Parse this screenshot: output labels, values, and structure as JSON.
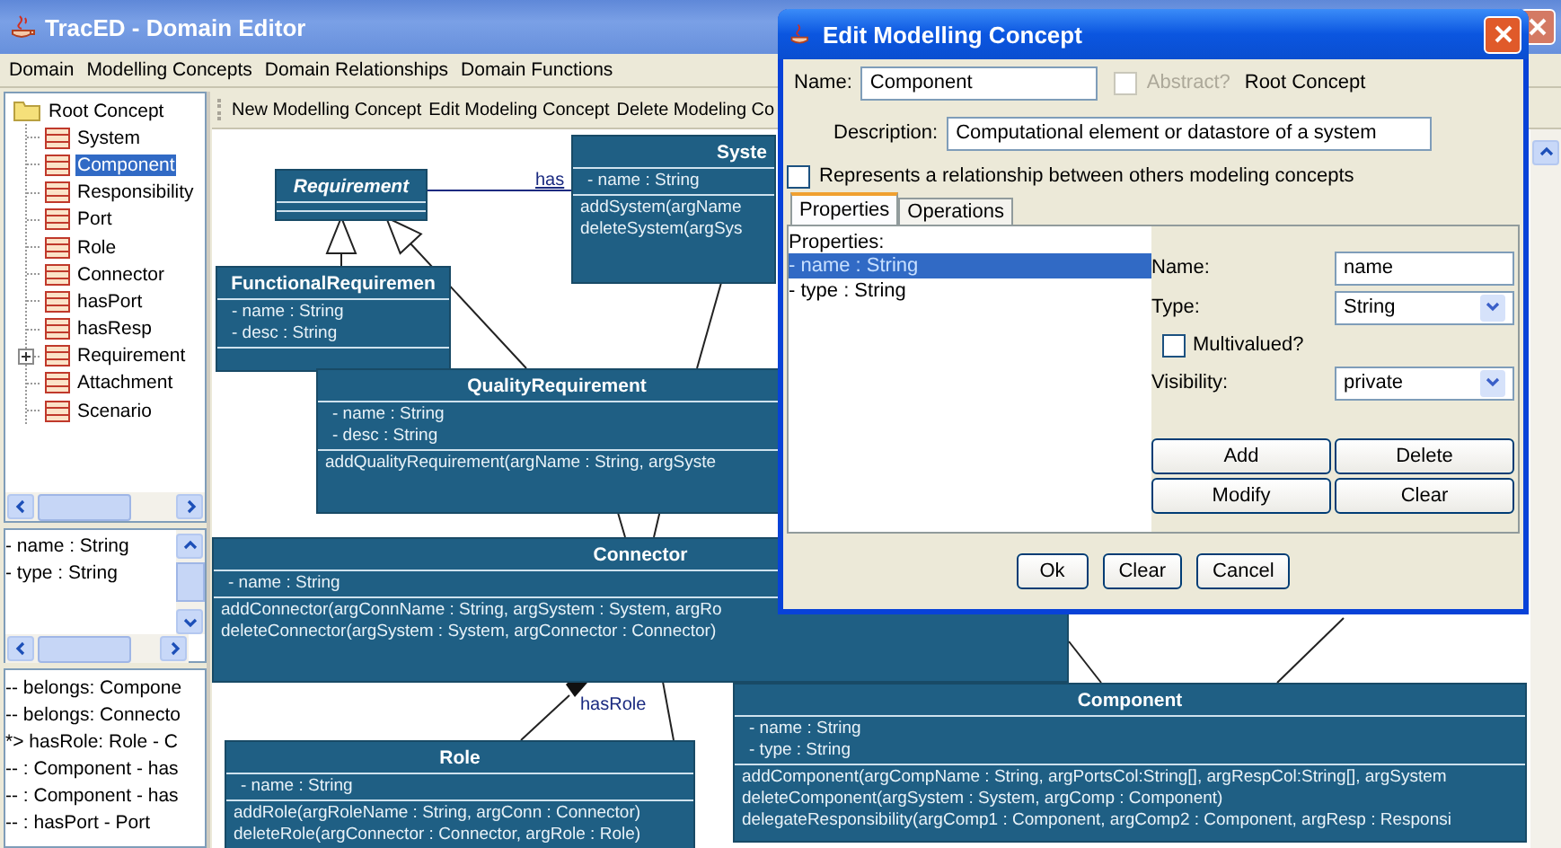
{
  "window": {
    "title": "TracED - Domain Editor"
  },
  "menu": [
    "Domain",
    "Modelling Concepts",
    "Domain Relationships",
    "Domain Functions"
  ],
  "toolbar": [
    "New Modelling Concept",
    "Edit Modeling Concept",
    "Delete Modeling Co"
  ],
  "tree": {
    "label": "Root Concept",
    "children": [
      {
        "label": "System",
        "selected": false,
        "collapsed": false
      },
      {
        "label": "Component",
        "selected": true,
        "collapsed": false
      },
      {
        "label": "Responsibility",
        "selected": false,
        "collapsed": false
      },
      {
        "label": "Port",
        "selected": false,
        "collapsed": false
      },
      {
        "label": "Role",
        "selected": false,
        "collapsed": false
      },
      {
        "label": "Connector",
        "selected": false,
        "collapsed": false
      },
      {
        "label": "hasPort",
        "selected": false,
        "collapsed": false
      },
      {
        "label": "hasResp",
        "selected": false,
        "collapsed": false
      },
      {
        "label": "Requirement",
        "selected": false,
        "collapsed": true
      },
      {
        "label": "Attachment",
        "selected": false,
        "collapsed": false
      },
      {
        "label": "Scenario",
        "selected": false,
        "collapsed": false
      }
    ]
  },
  "attributes": [
    "- name : String",
    "- type : String"
  ],
  "relations": [
    "-- belongs: Compone",
    "-- belongs: Connecto",
    "*> hasRole: Role - C",
    "-- : Component - has",
    "-- : Component - has",
    "-- : hasPort - Port"
  ],
  "diagram": {
    "classes": [
      {
        "name": "Requirement",
        "abstract": true
      },
      {
        "name": "Syste",
        "abstract": false,
        "attributes": [
          "- name : String"
        ],
        "operations": [
          "addSystem(argName",
          "deleteSystem(argSys"
        ]
      },
      {
        "name": "FunctionalRequiremen",
        "abstract": false,
        "attributes": [
          "- name : String",
          "- desc : String"
        ]
      },
      {
        "name": "QualityRequirement",
        "abstract": false,
        "attributes": [
          "- name : String",
          "- desc : String"
        ],
        "operations": [
          "addQualityRequirement(argName : String, argSyste"
        ]
      },
      {
        "name": "Connector",
        "abstract": false,
        "attributes": [
          "- name : String"
        ],
        "operations": [
          "addConnector(argConnName : String, argSystem : System, argRo",
          "deleteConnector(argSystem : System, argConnector : Connector)"
        ]
      },
      {
        "name": "Role",
        "abstract": false,
        "attributes": [
          "- name : String"
        ],
        "operations": [
          "addRole(argRoleName : String, argConn : Connector)",
          "deleteRole(argConnector : Connector, argRole : Role)"
        ]
      },
      {
        "name": "Component",
        "abstract": false,
        "attributes": [
          "- name : String",
          "- type : String"
        ],
        "operations": [
          "addComponent(argCompName : String, argPortsCol:String[], argRespCol:String[], argSystem",
          "deleteComponent(argSystem : System, argComp : Component)",
          "delegateResponsibility(argComp1 : Component, argComp2 : Component, argResp : Responsi"
        ]
      }
    ],
    "association_labels": [
      "has",
      "hasRole"
    ]
  },
  "dialog": {
    "title": "Edit Modelling Concept",
    "name_label": "Name:",
    "name_value": "Component",
    "abstract": {
      "label": "Abstract?",
      "checked": false,
      "disabled": true
    },
    "parent": "Root Concept",
    "description_label": "Description:",
    "description_value": "Computational element or datastore of a system",
    "relationship": {
      "label": "Represents a relationship between others modeling concepts",
      "checked": false
    },
    "tabs": [
      {
        "label": "Properties",
        "selected": true
      },
      {
        "label": "Operations",
        "selected": false
      }
    ],
    "properties_label": "Properties:",
    "properties": [
      {
        "text": "- name : String",
        "selected": true
      },
      {
        "text": "- type : String",
        "selected": false
      }
    ],
    "form": {
      "name_label": "Name:",
      "name_value": "name",
      "type_label": "Type:",
      "type_value": "String",
      "multivalued": {
        "label": "Multivalued?",
        "checked": false
      },
      "visibility_label": "Visibility:",
      "visibility_value": "private"
    },
    "form_buttons": [
      "Add",
      "Delete",
      "Modify",
      "Clear"
    ],
    "buttons": [
      "Ok",
      "Clear",
      "Cancel"
    ]
  }
}
